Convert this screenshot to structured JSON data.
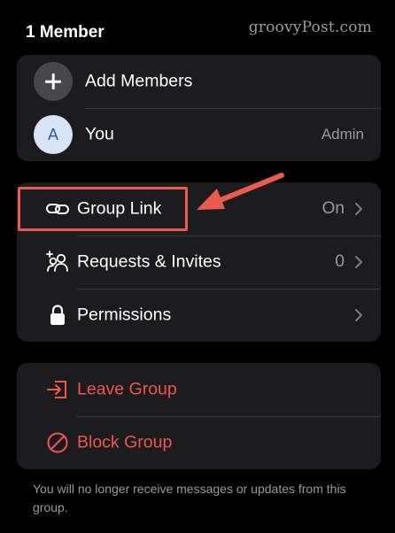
{
  "header": {
    "title": "1 Member"
  },
  "watermark": {
    "text": "groovyPost.com"
  },
  "members": {
    "add_label": "Add Members",
    "you": {
      "initial": "A",
      "label": "You",
      "role": "Admin"
    }
  },
  "settings": {
    "items": [
      {
        "label": "Group Link",
        "value": "On",
        "icon": "link-icon"
      },
      {
        "label": "Requests & Invites",
        "value": "0",
        "icon": "person-add-icon"
      },
      {
        "label": "Permissions",
        "value": "",
        "icon": "lock-icon"
      }
    ]
  },
  "danger": {
    "items": [
      {
        "label": "Leave Group",
        "icon": "leave-icon"
      },
      {
        "label": "Block Group",
        "icon": "block-icon"
      }
    ]
  },
  "footer": {
    "note": "You will no longer receive messages or updates from this group."
  },
  "colors": {
    "background": "#000000",
    "card": "#1c1c1e",
    "destructive": "#f0554b",
    "secondary_text": "#98989e",
    "annotation": "#ea5a4e"
  }
}
